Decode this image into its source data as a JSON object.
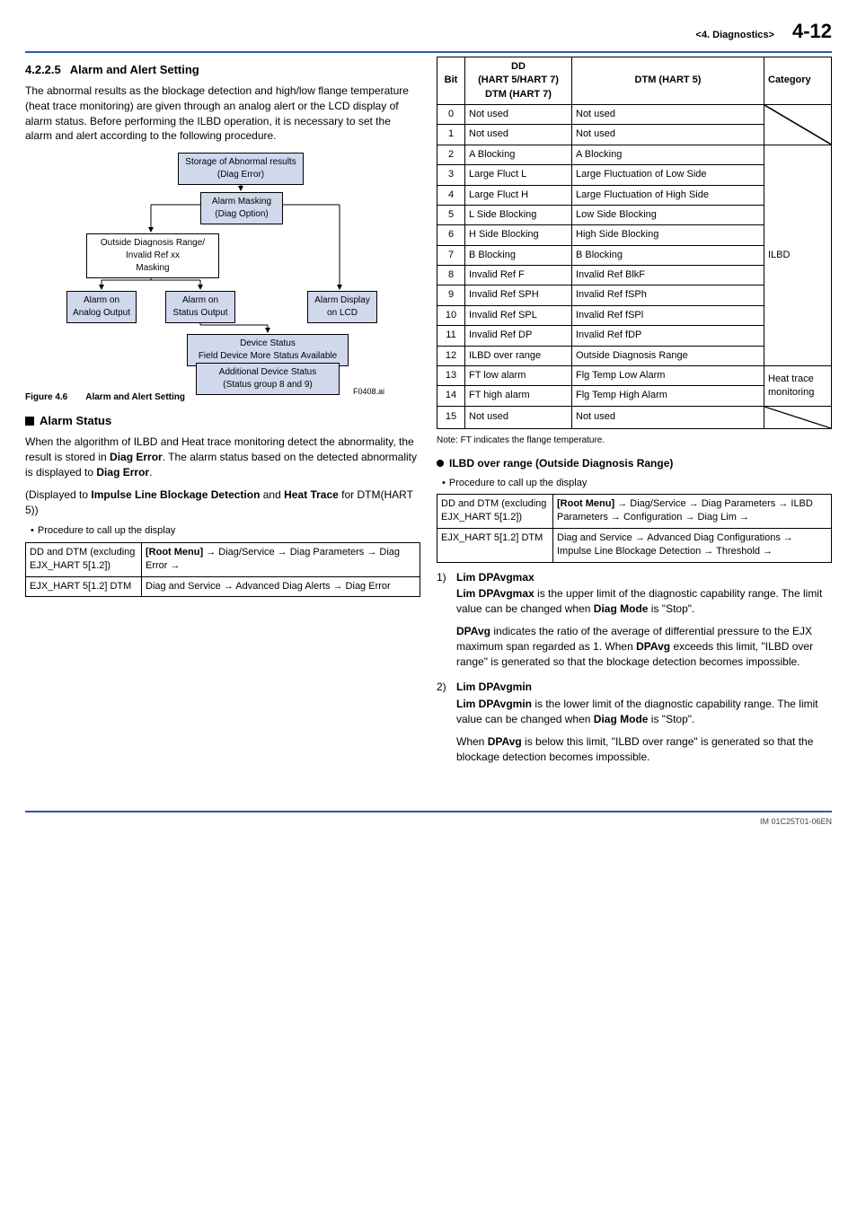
{
  "header": {
    "crumb": "<4.  Diagnostics>",
    "page": "4-12"
  },
  "left": {
    "sec_num": "4.2.2.5",
    "sec_title": "Alarm and Alert Setting",
    "intro": "The abnormal results as the blockage detection and high/low flange temperature (heat trace monitoring) are given through an analog alert or the LCD display of alarm status. Before performing the ILBD operation, it is necessary to set the alarm and alert according to the following procedure.",
    "flow": {
      "storage": "Storage of Abnormal results\n(Diag Error)",
      "masking": "Alarm Masking\n(Diag Option)",
      "outside": "Outside Diagnosis Range/\nInvalid Ref xx\nMasking",
      "analog": "Alarm on\nAnalog Output",
      "status": "Alarm on\nStatus Output",
      "lcd": "Alarm Display\non LCD",
      "device": "Device Status\nField Device More Status Available",
      "additional": "Additional Device Status\n(Status group 8 and 9)",
      "src": "F0408.ai"
    },
    "fig_id": "Figure 4.6",
    "fig_title": "Alarm and Alert Setting",
    "alarm_status_h": "Alarm Status",
    "alarm_status_p": "When the algorithm of ILBD and Heat trace monitoring detect the abnormality, the result is stored in ",
    "alarm_status_b1": "Diag Error",
    "alarm_status_p2": ". The alarm status based on the detected abnormality is displayed to ",
    "alarm_status_b2": "Diag Error",
    "alarm_status_p3": ".",
    "displayed_pre": "(Displayed to ",
    "displayed_b1": "Impulse Line Blockage Detection",
    "displayed_mid": " and ",
    "displayed_b2": "Heat Trace",
    "displayed_post": " for DTM(HART 5))",
    "proc_h": "Procedure to call up the display",
    "proc_rows": [
      {
        "l": "DD and DTM (excluding EJX_HART 5[1.2])",
        "r": "[Root Menu] → Diag/Service → Diag Parameters → Diag Error →",
        "rootbold": true
      },
      {
        "l": "EJX_HART 5[1.2] DTM",
        "r": "Diag and Service → Advanced Diag Alerts → Diag Error",
        "rootbold": false
      }
    ]
  },
  "right": {
    "bit_header": {
      "bit": "Bit",
      "dd": "DD\n(HART 5/HART 7)\nDTM (HART 7)",
      "dtm": "DTM (HART 5)",
      "cat": "Category"
    },
    "bit_rows": [
      {
        "bit": "0",
        "dd": "Not used",
        "dtm": "Not used"
      },
      {
        "bit": "1",
        "dd": "Not used",
        "dtm": "Not used"
      },
      {
        "bit": "2",
        "dd": "A Blocking",
        "dtm": "A Blocking"
      },
      {
        "bit": "3",
        "dd": "Large Fluct L",
        "dtm": "Large Fluctuation of Low Side"
      },
      {
        "bit": "4",
        "dd": "Large Fluct H",
        "dtm": "Large Fluctuation of High Side"
      },
      {
        "bit": "5",
        "dd": "L Side Blocking",
        "dtm": "Low Side Blocking"
      },
      {
        "bit": "6",
        "dd": "H Side Blocking",
        "dtm": "High Side Blocking"
      },
      {
        "bit": "7",
        "dd": "B Blocking",
        "dtm": "B Blocking"
      },
      {
        "bit": "8",
        "dd": "Invalid Ref F",
        "dtm": "Invalid Ref BlkF"
      },
      {
        "bit": "9",
        "dd": "Invalid Ref SPH",
        "dtm": "Invalid Ref fSPh"
      },
      {
        "bit": "10",
        "dd": "Invalid Ref SPL",
        "dtm": "Invalid Ref fSPl"
      },
      {
        "bit": "11",
        "dd": "Invalid Ref DP",
        "dtm": "Invalid Ref fDP"
      },
      {
        "bit": "12",
        "dd": "ILBD over range",
        "dtm": "Outside Diagnosis Range"
      },
      {
        "bit": "13",
        "dd": "FT low alarm",
        "dtm": "Flg Temp Low Alarm"
      },
      {
        "bit": "14",
        "dd": "FT high alarm",
        "dtm": "Flg Temp High Alarm"
      },
      {
        "bit": "15",
        "dd": "Not used",
        "dtm": "Not used"
      }
    ],
    "cat_ilbd": "ILBD",
    "cat_heat": "Heat trace monitoring",
    "note": "Note:  FT indicates the flange temperature.",
    "ilbd_h": "ILBD over range (Outside Diagnosis Range)",
    "proc_h": "Procedure to call up the display",
    "proc_rows": [
      {
        "l": "DD and DTM (excluding EJX_HART 5[1.2])",
        "r": "[Root Menu] → Diag/Service → Diag Parameters → ILBD Parameters → Configuration → Diag Lim →",
        "rootbold": true
      },
      {
        "l": "EJX_HART 5[1.2] DTM",
        "r": "Diag and Service → Advanced Diag Configurations → Impulse Line Blockage Detection → Threshold →",
        "rootbold": false
      }
    ],
    "list": [
      {
        "num": "1)",
        "title": "Lim DPAvgmax",
        "p1a": "Lim DPAvgmax",
        "p1b": " is the upper limit of the diagnostic capability range. The limit value can be changed when ",
        "p1c": "Diag Mode",
        "p1d": " is \"Stop\".",
        "p2a": "DPAvg",
        "p2b": " indicates the ratio of the average of differential pressure to the EJX maximum span regarded as 1. When ",
        "p2c": "DPAvg",
        "p2d": " exceeds this limit, \"ILBD over range\" is generated so that the blockage detection becomes impossible."
      },
      {
        "num": "2)",
        "title": "Lim DPAvgmin",
        "p1a": "Lim DPAvgmin",
        "p1b": " is the lower limit of the diagnostic capability range. The limit value can be changed when ",
        "p1c": "Diag Mode",
        "p1d": " is \"Stop\".",
        "p2a": "",
        "p2b": "When ",
        "p2c": "DPAvg",
        "p2d": " is below this limit, \"ILBD over range\" is generated so that the blockage detection becomes impossible."
      }
    ]
  },
  "footer": {
    "doc_id": "IM 01C25T01-06EN"
  }
}
